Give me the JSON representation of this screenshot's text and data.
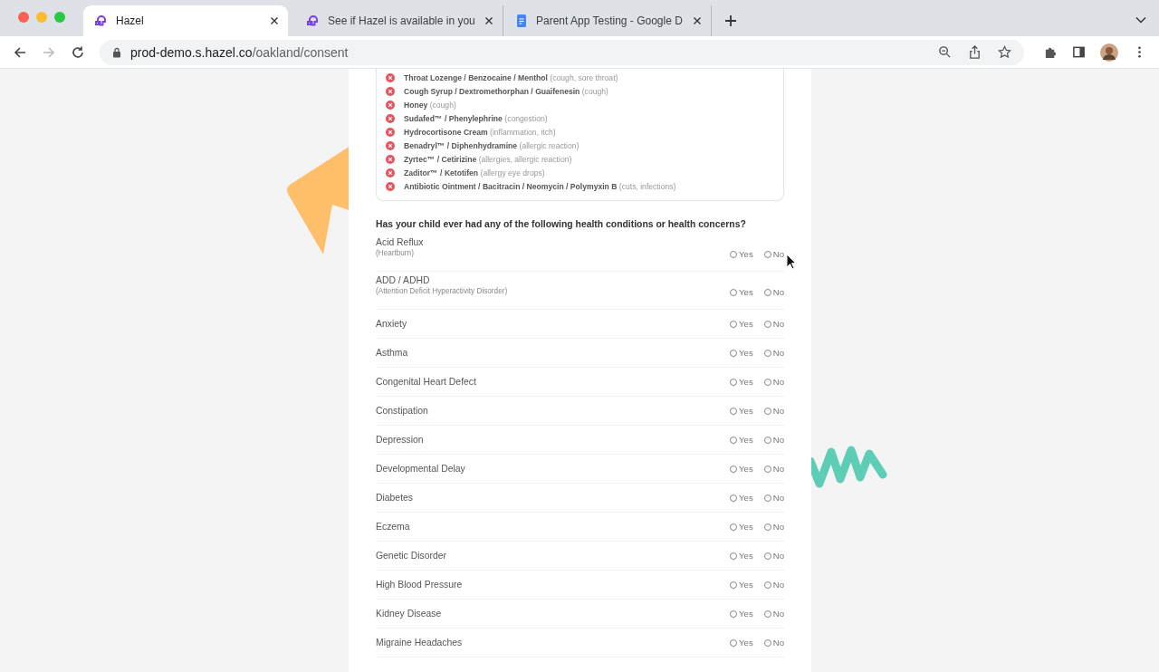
{
  "browser": {
    "tabs": [
      {
        "title": "Hazel",
        "kind": "app",
        "selected": true
      },
      {
        "title": "See if Hazel is available in you",
        "kind": "app",
        "selected": false
      },
      {
        "title": "Parent App Testing - Google D",
        "kind": "document",
        "selected": false
      }
    ],
    "url": {
      "host": "prod-demo.s.hazel.co",
      "path": "/oakland/consent"
    }
  },
  "medications": [
    {
      "name": "Throat Lozenge / Benzocaine / Menthol",
      "note": "(cough, sore throat)"
    },
    {
      "name": "Cough Syrup / Dextromethorphan / Guaifenesin",
      "note": "(cough)"
    },
    {
      "name": "Honey",
      "note": "(cough)"
    },
    {
      "name": "Sudafed™ / Phenylephrine",
      "note": "(congestion)"
    },
    {
      "name": "Hydrocortisone Cream",
      "note": "(inflammation, itch)"
    },
    {
      "name": "Benadryl™ / Diphenhydramine",
      "note": "(allergic reaction)"
    },
    {
      "name": "Zyrtec™ / Cetirizine",
      "note": "(allergies, allergic reaction)"
    },
    {
      "name": "Zaditor™ / Ketotifen",
      "note": "(allergy eye drops)"
    },
    {
      "name": "Antibiotic Ointment / Bacitracin / Neomycin / Polymyxin B",
      "note": "(cuts, infections)"
    }
  ],
  "question": "Has your child ever had any of the following health conditions or health concerns?",
  "conditions": [
    {
      "name": "Acid Reflux",
      "detail": "(Heartburn)",
      "options": [
        {
          "label": "Yes",
          "selected": false
        },
        {
          "label": "No",
          "selected": false
        }
      ]
    },
    {
      "name": "ADD / ADHD",
      "detail": "(Attention Deficit Hyperactivity Disorder)",
      "options": [
        {
          "label": "Yes",
          "selected": false
        },
        {
          "label": "No",
          "selected": false
        }
      ]
    },
    {
      "name": "Anxiety",
      "options": [
        {
          "label": "Yes",
          "selected": false
        },
        {
          "label": "No",
          "selected": false
        }
      ]
    },
    {
      "name": "Asthma",
      "options": [
        {
          "label": "Yes",
          "selected": false
        },
        {
          "label": "No",
          "selected": false
        }
      ]
    },
    {
      "name": "Congenital Heart Defect",
      "options": [
        {
          "label": "Yes",
          "selected": false
        },
        {
          "label": "No",
          "selected": false
        }
      ]
    },
    {
      "name": "Constipation",
      "options": [
        {
          "label": "Yes",
          "selected": false
        },
        {
          "label": "No",
          "selected": false
        }
      ]
    },
    {
      "name": "Depression",
      "options": [
        {
          "label": "Yes",
          "selected": false
        },
        {
          "label": "No",
          "selected": false
        }
      ]
    },
    {
      "name": "Developmental Delay",
      "options": [
        {
          "label": "Yes",
          "selected": false
        },
        {
          "label": "No",
          "selected": false
        }
      ]
    },
    {
      "name": "Diabetes",
      "options": [
        {
          "label": "Yes",
          "selected": false
        },
        {
          "label": "No",
          "selected": false
        }
      ]
    },
    {
      "name": "Eczema",
      "options": [
        {
          "label": "Yes",
          "selected": false
        },
        {
          "label": "No",
          "selected": false
        }
      ]
    },
    {
      "name": "Genetic Disorder",
      "options": [
        {
          "label": "Yes",
          "selected": false
        },
        {
          "label": "No",
          "selected": false
        }
      ]
    },
    {
      "name": "High Blood Pressure",
      "options": [
        {
          "label": "Yes",
          "selected": false
        },
        {
          "label": "No",
          "selected": false
        }
      ]
    },
    {
      "name": "Kidney Disease",
      "options": [
        {
          "label": "Yes",
          "selected": false
        },
        {
          "label": "No",
          "selected": false
        }
      ]
    },
    {
      "name": "Migraine Headaches",
      "options": [
        {
          "label": "Yes",
          "selected": false
        },
        {
          "label": "No",
          "selected": false
        }
      ]
    }
  ]
}
